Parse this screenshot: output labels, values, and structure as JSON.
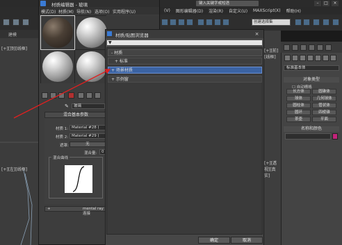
{
  "main": {
    "menu": [
      "(V)",
      "图形编辑器(D)",
      "渲染(R)",
      "自定义(U)",
      "MAXScript(X)",
      "帮助(H)"
    ],
    "search_placeholder": "键入关键字或短语",
    "selection_set": "创建选择集",
    "left_tab": "建模",
    "viewport_label_top": "[+][顶][线框]",
    "viewport_label_left": "[+][左][线框]",
    "viewport_label_right_top": "[+][前][线框]",
    "viewport_label_right_bottom": "[+][透视][真实]",
    "cmd_dropdown": "标准基本体",
    "cmd_section_object": "对象类型",
    "cmd_autogrid": "自动栅格",
    "cmd_buttons": [
      "长方体",
      "圆锥体",
      "球体",
      "几何球体",
      "圆柱体",
      "管状体",
      "圆环",
      "四棱锥",
      "茶壶",
      "平面"
    ],
    "cmd_section_name": "名称和颜色",
    "swatch_color": "#c3237a"
  },
  "material_editor": {
    "title": "材质编辑器 - 玻璃",
    "menu": [
      "模式(D)",
      "材质(M)",
      "导航(N)",
      "选项(O)",
      "实用程序(U)"
    ],
    "material_name": "玻璃",
    "rollout_title": "混合基本参数",
    "material1_label": "材质 1:",
    "material1_value": "Material #28 ( Stan",
    "material2_label": "材质 2:",
    "material2_value": "Material #29 ( Stan",
    "mask_label": "遮罩:",
    "mask_value": "无",
    "mix_amount_label": "混合量:",
    "mix_amount_value": "0",
    "curve_group": "混合曲线",
    "bottom_rollout": "mental ray 连接"
  },
  "browser": {
    "title": "材质/贴图浏览器",
    "search_placeholder": "按名称搜索...",
    "rows": [
      {
        "label": "- 材质",
        "style": "h1"
      },
      {
        "label": "+ 标准",
        "style": "sub"
      },
      {
        "label": "+ 场景材质",
        "style": "sel"
      },
      {
        "label": "+ 示例窗",
        "style": "plain"
      }
    ],
    "ok_label": "确定",
    "cancel_label": "取消"
  }
}
